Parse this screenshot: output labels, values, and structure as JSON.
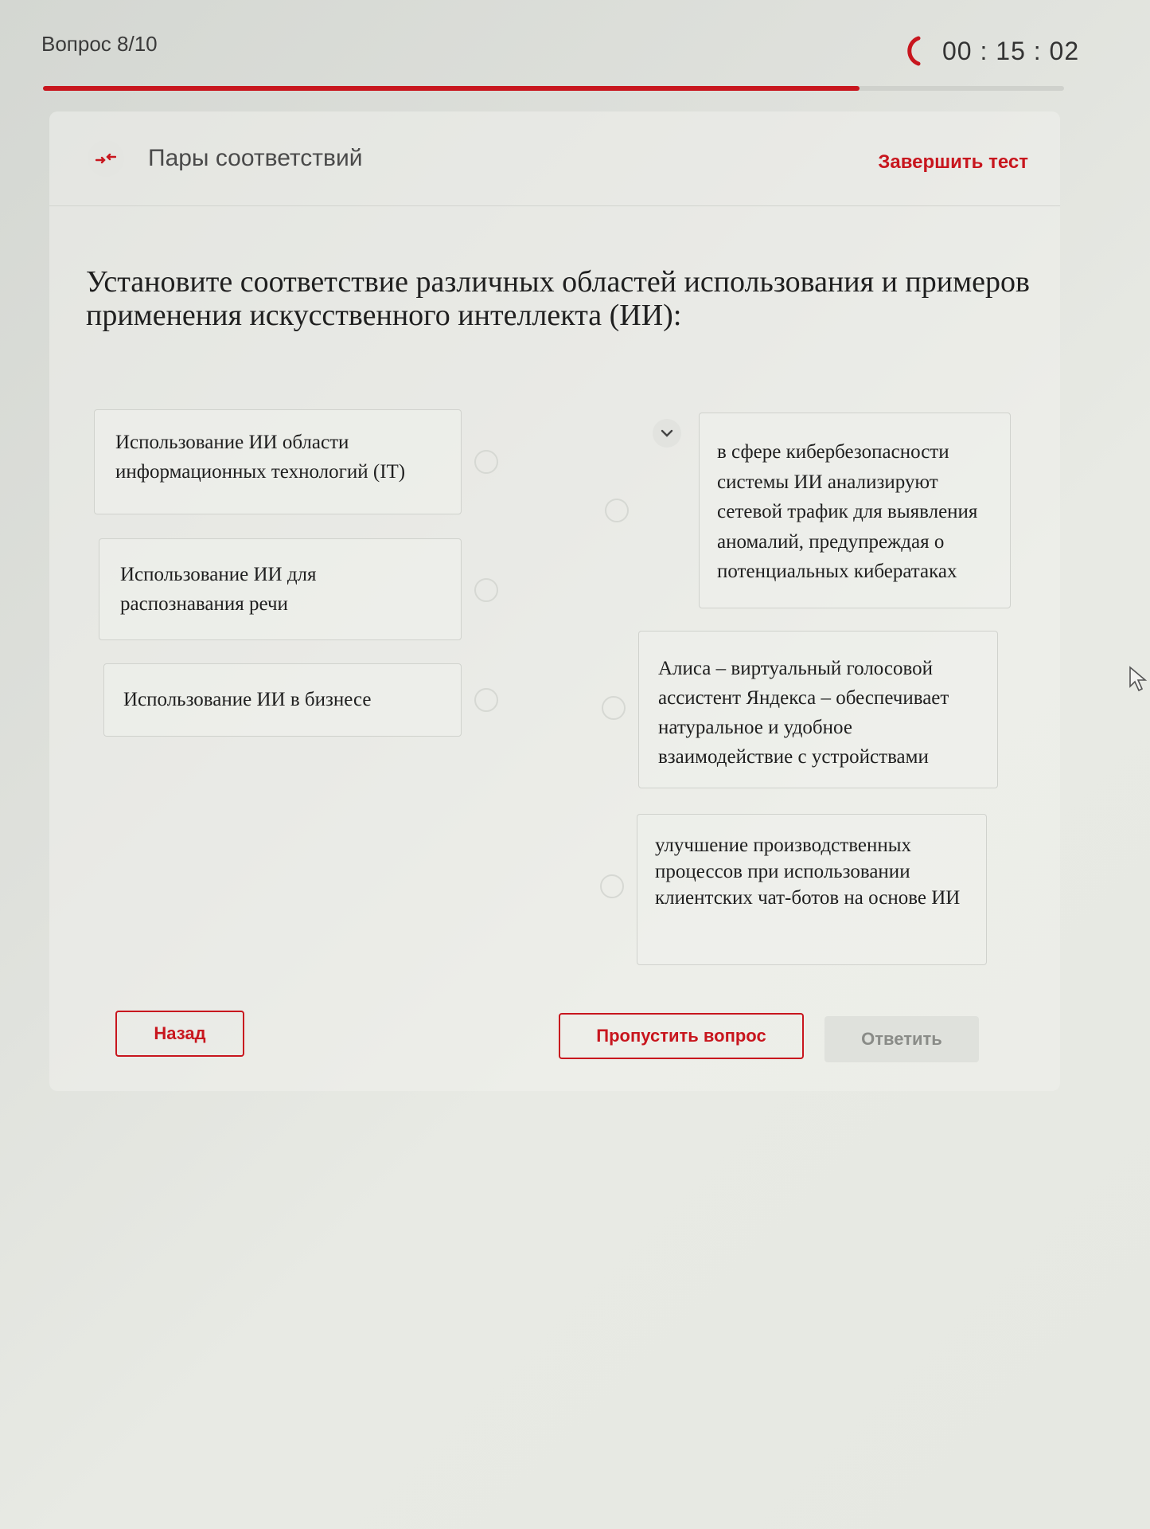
{
  "header": {
    "question_counter": "Вопрос 8/10",
    "timer": "00 : 15 : 02",
    "timer_icon": "timer-arc-icon",
    "progress_fraction": 0.8,
    "accent_color": "#c8161e"
  },
  "card": {
    "type_label": "Пары соответствий",
    "type_icon": "pairs-arrows-icon",
    "finish_link": "Завершить тест"
  },
  "question": {
    "text": "Установите соответствие различных областей использования и примеров применения искусственного интеллекта (ИИ):"
  },
  "left_items": [
    {
      "text": "Использование ИИ области информационных технологий (IT)"
    },
    {
      "text": "Использование ИИ для распознавания речи"
    },
    {
      "text": "Использование ИИ в бизнесе"
    }
  ],
  "right_items": [
    {
      "text": "в сфере кибербезопасности системы ИИ анализируют сетевой трафик для выявления аномалий, предупреждая о потенциальных кибератаках"
    },
    {
      "text": "Алиса – виртуальный голосовой ассистент Яндекса – обеспечивает натуральное и удобное взаимодействие с устройствами"
    },
    {
      "text": "улучшение производственных процессов при использовании клиентских чат-ботов на основе ИИ"
    }
  ],
  "buttons": {
    "back": "Назад",
    "skip": "Пропустить вопрос",
    "answer": "Ответить"
  }
}
